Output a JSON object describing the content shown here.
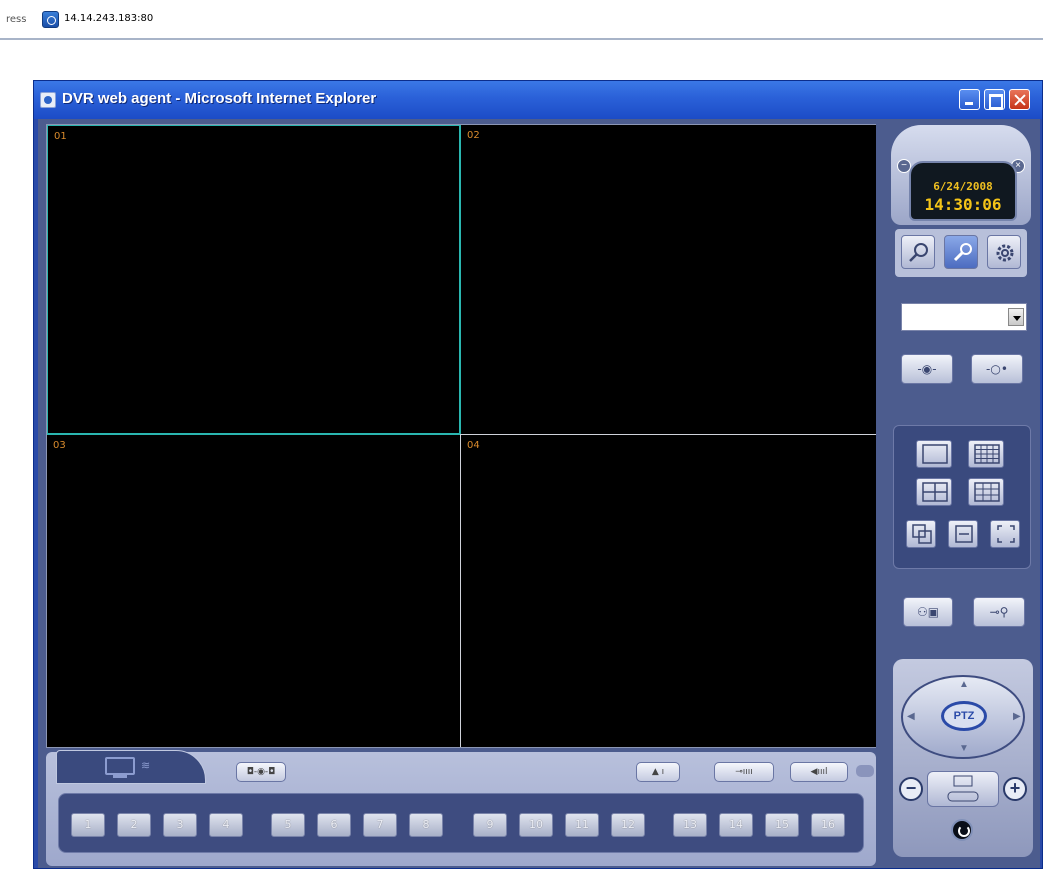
{
  "address_bar": {
    "label": "ress",
    "url": "14.14.243.183:80"
  },
  "window": {
    "title": "DVR web agent - Microsoft Internet Explorer"
  },
  "cameras": [
    {
      "label": "01"
    },
    {
      "label": "02"
    },
    {
      "label": "03"
    },
    {
      "label": "04"
    }
  ],
  "clock": {
    "date": "6/24/2008",
    "time": "14:30:06"
  },
  "colors": {
    "accent_teal": "#2ab6b0",
    "clock_yellow": "#f4c418",
    "channel_label": "#d88a2c",
    "title_blue": "#2a60d8"
  },
  "icons": {
    "search": "search-icon",
    "settings_tool": "wrench-icon",
    "config": "gear-icon",
    "zoom_in": "zoom-in-icon",
    "zoom_out": "zoom-out-icon"
  },
  "channels": [
    "1",
    "2",
    "3",
    "4",
    "5",
    "6",
    "7",
    "8",
    "9",
    "10",
    "11",
    "12",
    "13",
    "14",
    "15",
    "16"
  ],
  "ptz": {
    "label": "PTZ"
  }
}
